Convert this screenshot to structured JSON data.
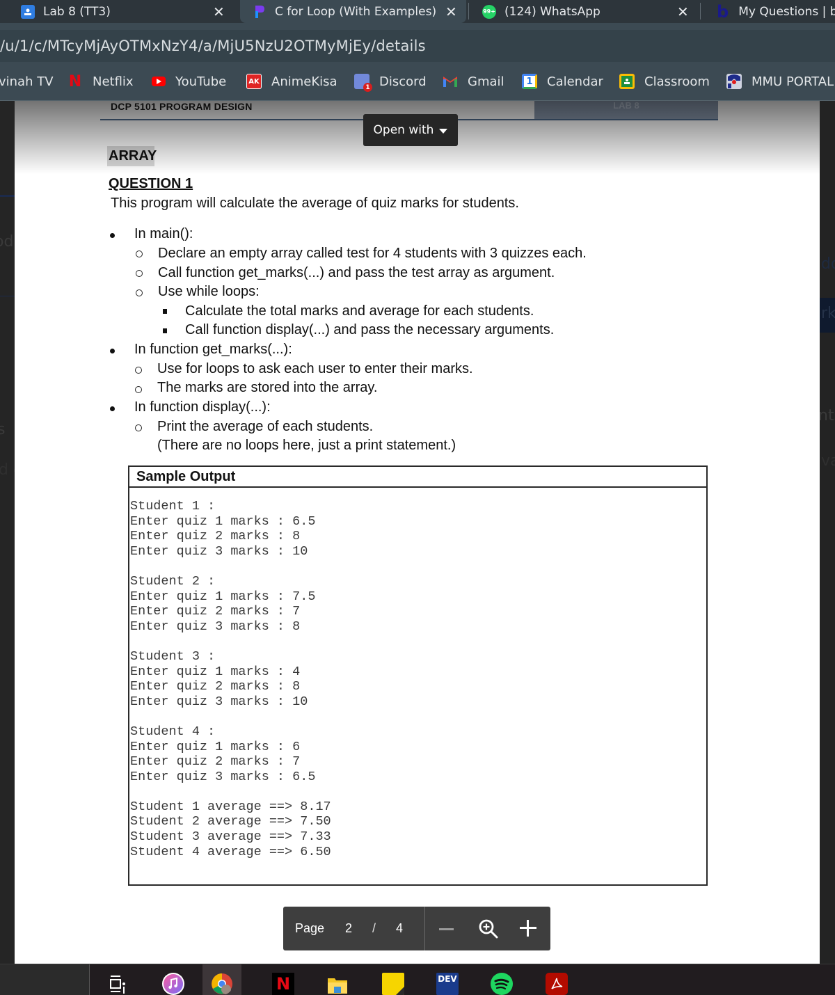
{
  "browser": {
    "tabs": [
      {
        "title": "Lab 8 (TT3)",
        "icon": "google-classroom-icon",
        "active": false
      },
      {
        "title": "C for Loop (With Examples)",
        "icon": "programiz-icon",
        "active": true
      },
      {
        "title": "(124) WhatsApp",
        "icon": "whatsapp-icon",
        "badge": "99+",
        "active": false
      },
      {
        "title": "My Questions | b",
        "icon": "bartleby-icon",
        "active": false
      }
    ],
    "close_glyph": "✕",
    "url": "/u/1/c/MTcyMjAyOTMxNzY4/a/MjU5NzU2OTMyMjEy/details",
    "bookmarks": [
      {
        "label": "vinah TV",
        "icon": "none"
      },
      {
        "label": "Netflix",
        "icon": "netflix-icon"
      },
      {
        "label": "YouTube",
        "icon": "youtube-icon"
      },
      {
        "label": "AnimeKisa",
        "icon": "animekisa-icon",
        "glyph": "AK"
      },
      {
        "label": "Discord",
        "icon": "discord-icon",
        "badge": "1"
      },
      {
        "label": "Gmail",
        "icon": "gmail-icon"
      },
      {
        "label": "Calendar",
        "icon": "calendar-icon",
        "glyph": "1"
      },
      {
        "label": "Classroom",
        "icon": "classroom-icon"
      },
      {
        "label": "MMU PORTAL",
        "icon": "mmu-portal-icon"
      }
    ]
  },
  "background_fragments": [
    "odu",
    "dd",
    "rk",
    "s",
    "nts",
    "d c",
    "va"
  ],
  "viewer": {
    "open_with_label": "Open with",
    "doc_header": {
      "course": "DCP 5101 PROGRAM DESIGN",
      "lab": "LAB 8"
    },
    "section_title": "ARRAY",
    "question_title": "QUESTION 1",
    "question_desc": "This program will calculate the average of quiz marks for students.",
    "instructions": [
      {
        "level": 1,
        "text": "In main():"
      },
      {
        "level": 2,
        "text": "Declare an empty array called test for 4 students with 3 quizzes each."
      },
      {
        "level": 2,
        "text": "Call function get_marks(...) and pass the test array as argument."
      },
      {
        "level": 2,
        "text": "Use while loops:"
      },
      {
        "level": 3,
        "text": "Calculate the total marks and average for each students."
      },
      {
        "level": 3,
        "text": "Call function display(...) and pass the necessary arguments."
      },
      {
        "level": 1,
        "text": "In function get_marks(...):"
      },
      {
        "level": 2,
        "text": "Use for loops to ask each user to enter their marks."
      },
      {
        "level": 2,
        "text": "The marks are stored into the array."
      },
      {
        "level": 1,
        "text": "In function display(...):"
      },
      {
        "level": 2,
        "text": "Print the average of each students."
      },
      {
        "level": 0,
        "text": "(There are no loops here, just a print statement.)"
      }
    ],
    "sample_output": {
      "heading": "Sample Output",
      "lines": [
        "Student 1 :",
        "Enter quiz 1 marks : 6.5",
        "Enter quiz 2 marks : 8",
        "Enter quiz 3 marks : 10",
        "",
        "Student 2 :",
        "Enter quiz 1 marks : 7.5",
        "Enter quiz 2 marks : 7",
        "Enter quiz 3 marks : 8",
        "",
        "Student 3 :",
        "Enter quiz 1 marks : 4",
        "Enter quiz 2 marks : 8",
        "Enter quiz 3 marks : 10",
        "",
        "Student 4 :",
        "Enter quiz 1 marks : 6",
        "Enter quiz 2 marks : 7",
        "Enter quiz 3 marks : 6.5",
        "",
        "Student 1 average ==> 8.17",
        "Student 2 average ==> 7.50",
        "Student 3 average ==> 7.33",
        "Student 4 average ==> 6.50"
      ]
    },
    "pager": {
      "label": "Page",
      "current": "2",
      "separator": "/",
      "total": "4"
    }
  },
  "taskbar": {
    "apps": [
      {
        "name": "task-view-icon"
      },
      {
        "name": "itunes-icon"
      },
      {
        "name": "chrome-icon",
        "active": true
      },
      {
        "name": "netflix-app-icon",
        "glyph": "N"
      },
      {
        "name": "file-explorer-icon"
      },
      {
        "name": "sticky-notes-icon"
      },
      {
        "name": "dev-cpp-icon",
        "glyph": "DEV"
      },
      {
        "name": "spotify-icon"
      },
      {
        "name": "acrobat-reader-icon"
      }
    ]
  }
}
